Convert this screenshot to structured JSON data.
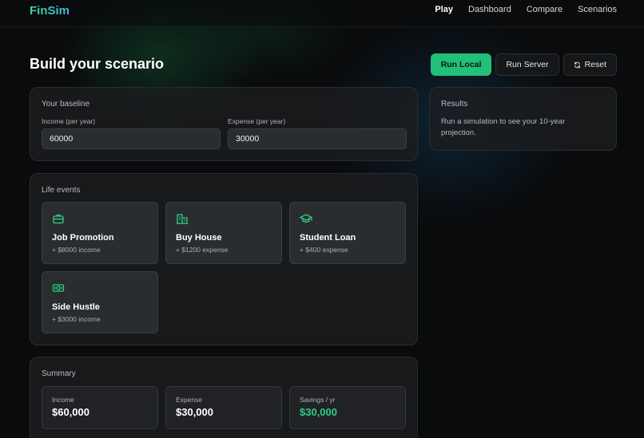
{
  "app": {
    "brand": "FinSim"
  },
  "nav": {
    "items": [
      "Play",
      "Dashboard",
      "Compare",
      "Scenarios"
    ],
    "active": "Play"
  },
  "page": {
    "title": "Build your scenario"
  },
  "actions": {
    "run_local": "Run Local",
    "run_server": "Run Server",
    "reset": "Reset"
  },
  "baseline": {
    "title": "Your baseline",
    "income_label": "Income (per year)",
    "income_value": "60000",
    "expense_label": "Expense (per year)",
    "expense_value": "30000"
  },
  "results": {
    "title": "Results",
    "message": "Run a simulation to see your 10-year projection."
  },
  "life_events": {
    "title": "Life events",
    "items": [
      {
        "name": "Job Promotion",
        "desc": "+ $8000 income",
        "icon": "briefcase-icon"
      },
      {
        "name": "Buy House",
        "desc": "+ $1200 expense",
        "icon": "building-icon"
      },
      {
        "name": "Student Loan",
        "desc": "+ $400 expense",
        "icon": "graduation-cap-icon"
      },
      {
        "name": "Side Hustle",
        "desc": "+ $3000 income",
        "icon": "banknote-icon"
      }
    ]
  },
  "summary": {
    "title": "Summary",
    "items": [
      {
        "label": "Income",
        "value": "$60,000"
      },
      {
        "label": "Expense",
        "value": "$30,000"
      },
      {
        "label": "Savings / yr",
        "value": "$30,000"
      }
    ]
  },
  "colors": {
    "accent": "#22c07a",
    "brand_start": "#3fd68f",
    "brand_end": "#3fb8e0",
    "savings": "#2fcf84"
  }
}
